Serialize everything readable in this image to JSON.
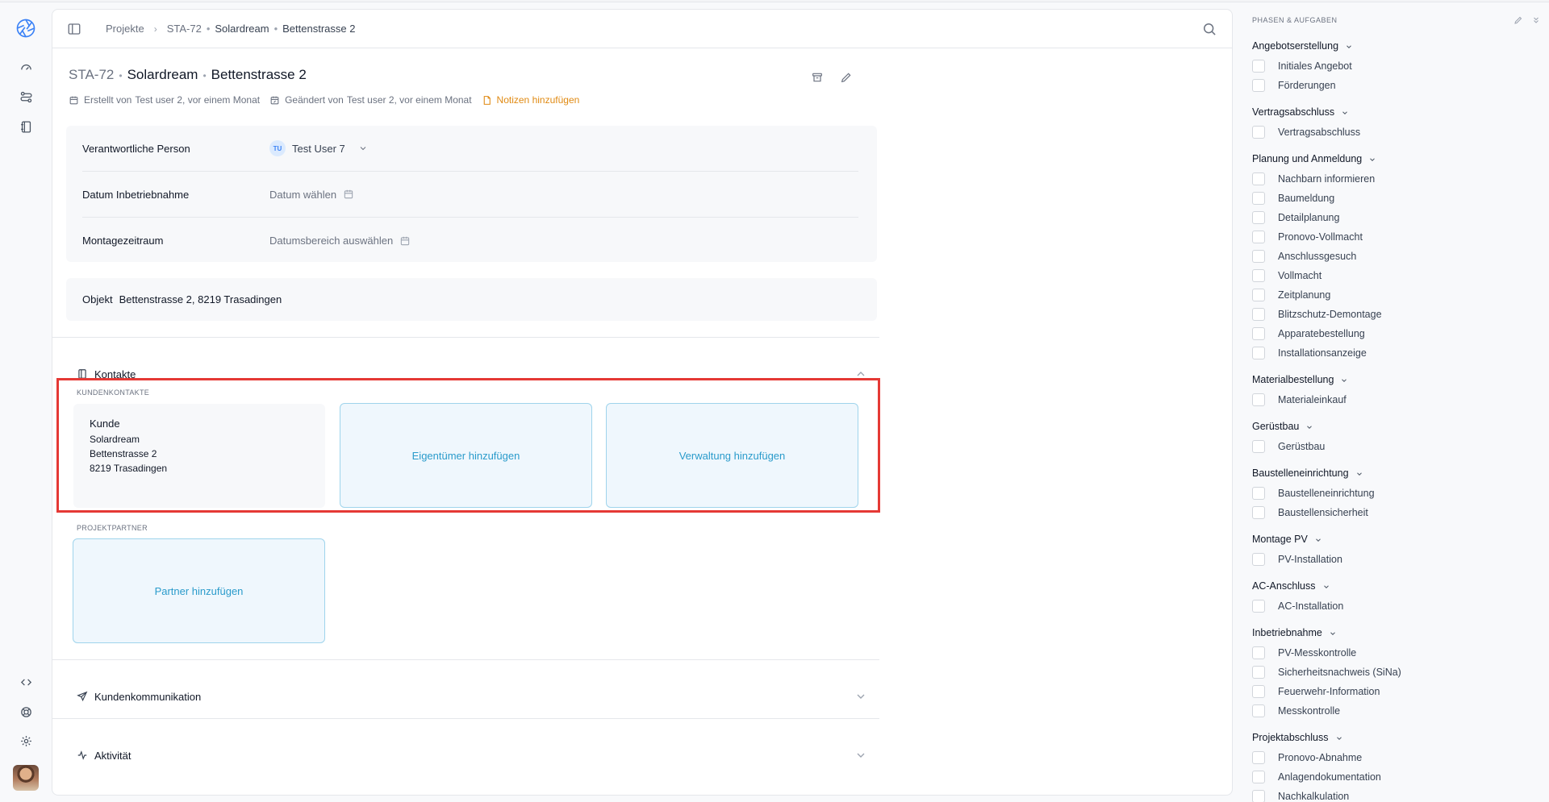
{
  "breadcrumb": {
    "root": "Projekte",
    "code": "STA-72",
    "customer": "Solardream",
    "address": "Bettenstrasse 2"
  },
  "project": {
    "code": "STA-72",
    "customer": "Solardream",
    "address": "Bettenstrasse 2",
    "created_label": "Erstellt von",
    "created_value": "Test user 2, vor einem Monat",
    "changed_label": "Geändert von",
    "changed_value": "Test user 2, vor einem Monat",
    "notes_label": "Notizen hinzufügen"
  },
  "properties": {
    "responsible_label": "Verantwortliche Person",
    "responsible_initials": "TU",
    "responsible_value": "Test User 7",
    "commissioning_label": "Datum Inbetriebnahme",
    "commissioning_placeholder": "Datum wählen",
    "assembly_label": "Montagezeitraum",
    "assembly_placeholder": "Datumsbereich auswählen"
  },
  "objekt": {
    "label": "Objekt",
    "value": "Bettenstrasse 2, 8219 Trasadingen"
  },
  "contacts": {
    "title": "Kontakte",
    "customer_contacts_label": "KUNDENKONTAKTE",
    "kunde": {
      "title": "Kunde",
      "lines": [
        "Solardream",
        "Bettenstrasse 2",
        "8219 Trasadingen"
      ]
    },
    "add_owner": "Eigentümer hinzufügen",
    "add_management": "Verwaltung hinzufügen",
    "partners_label": "PROJEKTPARTNER",
    "add_partner": "Partner hinzufügen"
  },
  "sections": {
    "communication": "Kundenkommunikation",
    "activity": "Aktivität"
  },
  "right_panel": {
    "title": "PHASEN & AUFGABEN",
    "phases": [
      {
        "name": "Angebotserstellung",
        "tasks": [
          "Initiales Angebot",
          "Förderungen"
        ]
      },
      {
        "name": "Vertragsabschluss",
        "tasks": [
          "Vertragsabschluss"
        ]
      },
      {
        "name": "Planung und Anmeldung",
        "tasks": [
          "Nachbarn informieren",
          "Baumeldung",
          "Detailplanung",
          "Pronovo-Vollmacht",
          "Anschlussgesuch",
          "Vollmacht",
          "Zeitplanung",
          "Blitzschutz-Demontage",
          "Apparatebestellung",
          "Installationsanzeige"
        ]
      },
      {
        "name": "Materialbestellung",
        "tasks": [
          "Materialeinkauf"
        ]
      },
      {
        "name": "Gerüstbau",
        "tasks": [
          "Gerüstbau"
        ]
      },
      {
        "name": "Baustelleneinrichtung",
        "tasks": [
          "Baustelleneinrichtung",
          "Baustellensicherheit"
        ]
      },
      {
        "name": "Montage PV",
        "tasks": [
          "PV-Installation"
        ]
      },
      {
        "name": "AC-Anschluss",
        "tasks": [
          "AC-Installation"
        ]
      },
      {
        "name": "Inbetriebnahme",
        "tasks": [
          "PV-Messkontrolle",
          "Sicherheitsnachweis (SiNa)",
          "Feuerwehr-Information",
          "Messkontrolle"
        ]
      },
      {
        "name": "Projektabschluss",
        "tasks": [
          "Pronovo-Abnahme",
          "Anlagendokumentation",
          "Nachkalkulation"
        ]
      }
    ]
  },
  "colors": {
    "accent": "#2a9bcb",
    "notes": "#e08a13",
    "highlight": "#e53935"
  }
}
